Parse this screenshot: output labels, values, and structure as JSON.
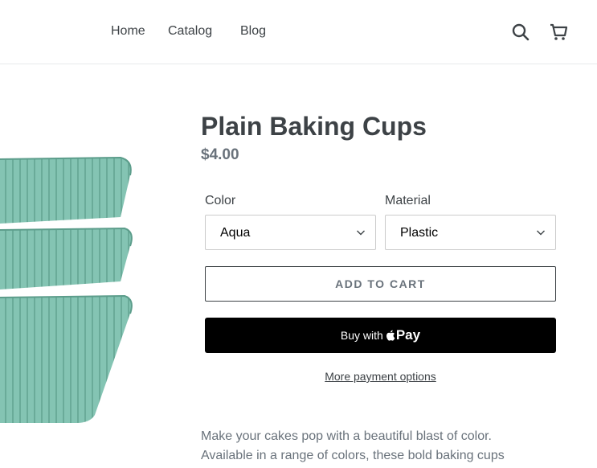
{
  "nav": {
    "home": "Home",
    "catalog": "Catalog",
    "blog": "Blog"
  },
  "icons": {
    "search": "search-icon",
    "cart": "cart-icon"
  },
  "product": {
    "title": "Plain Baking Cups",
    "price": "$4.00",
    "image_color": "#7fbfae"
  },
  "options": {
    "color_label": "Color",
    "color_value": "Aqua",
    "material_label": "Material",
    "material_value": "Plastic"
  },
  "buttons": {
    "add_to_cart": "ADD TO CART",
    "buy_with": "Buy with",
    "pay": "Pay",
    "more_payment": "More payment options"
  },
  "description": {
    "line1": "Make your cakes pop with a beautiful blast of color.",
    "line2": "Available in a range of colors, these bold baking cups"
  }
}
